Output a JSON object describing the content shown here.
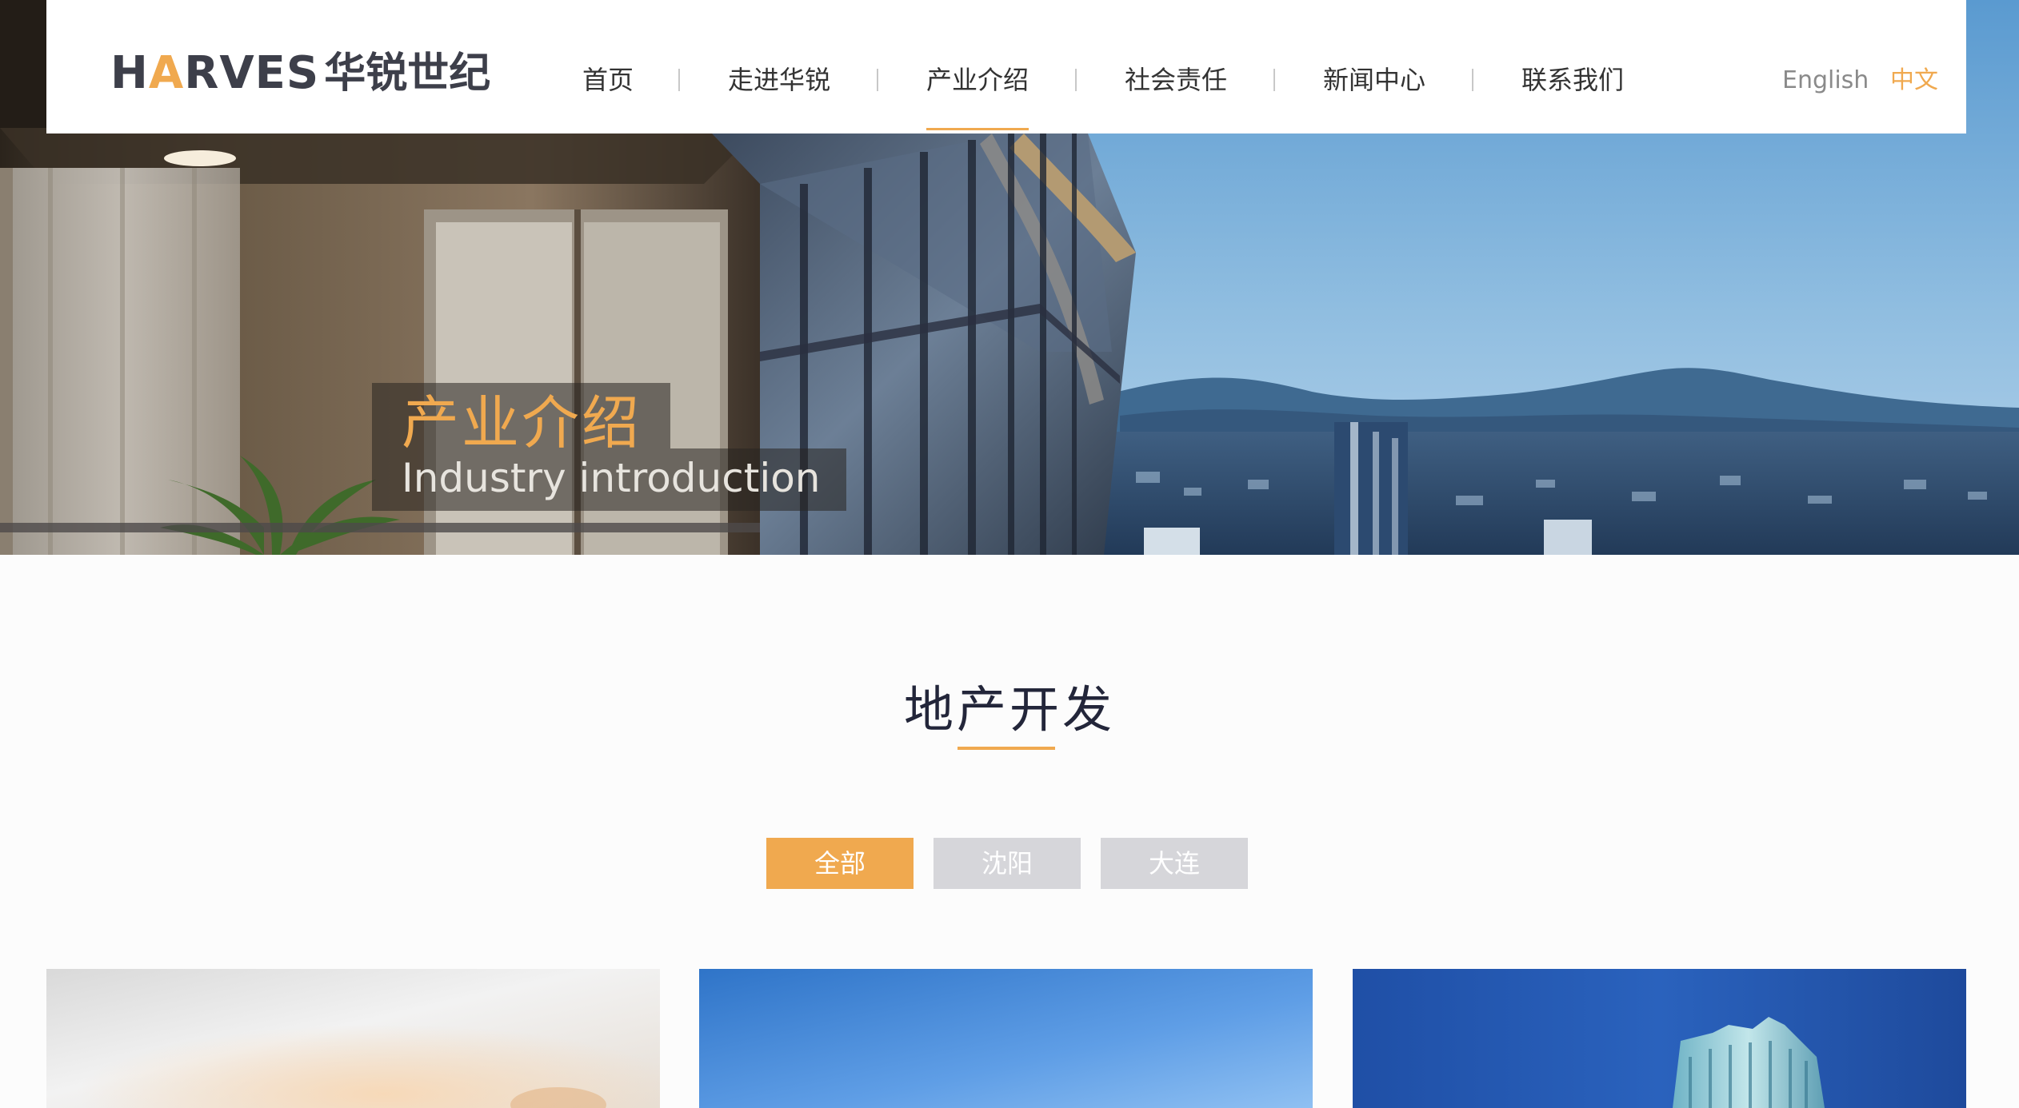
{
  "header": {
    "logo": {
      "latin": "HARVES",
      "chinese": "华锐世纪"
    },
    "nav": [
      {
        "label": "首页",
        "active": false
      },
      {
        "label": "走进华锐",
        "active": false
      },
      {
        "label": "产业介绍",
        "active": true
      },
      {
        "label": "社会责任",
        "active": false
      },
      {
        "label": "新闻中心",
        "active": false
      },
      {
        "label": "联系我们",
        "active": false
      }
    ],
    "languages": {
      "english": "English",
      "chinese": "中文"
    }
  },
  "hero": {
    "title": "产业介绍",
    "subtitle": "Industry introduction"
  },
  "section": {
    "title": "地产开发",
    "filters": [
      {
        "label": "全部",
        "active": true
      },
      {
        "label": "沈阳",
        "active": false
      },
      {
        "label": "大连",
        "active": false
      }
    ]
  },
  "colors": {
    "accent": "#f0a94f",
    "inactive_filter": "#d6d6da",
    "title_text": "#23263a"
  }
}
